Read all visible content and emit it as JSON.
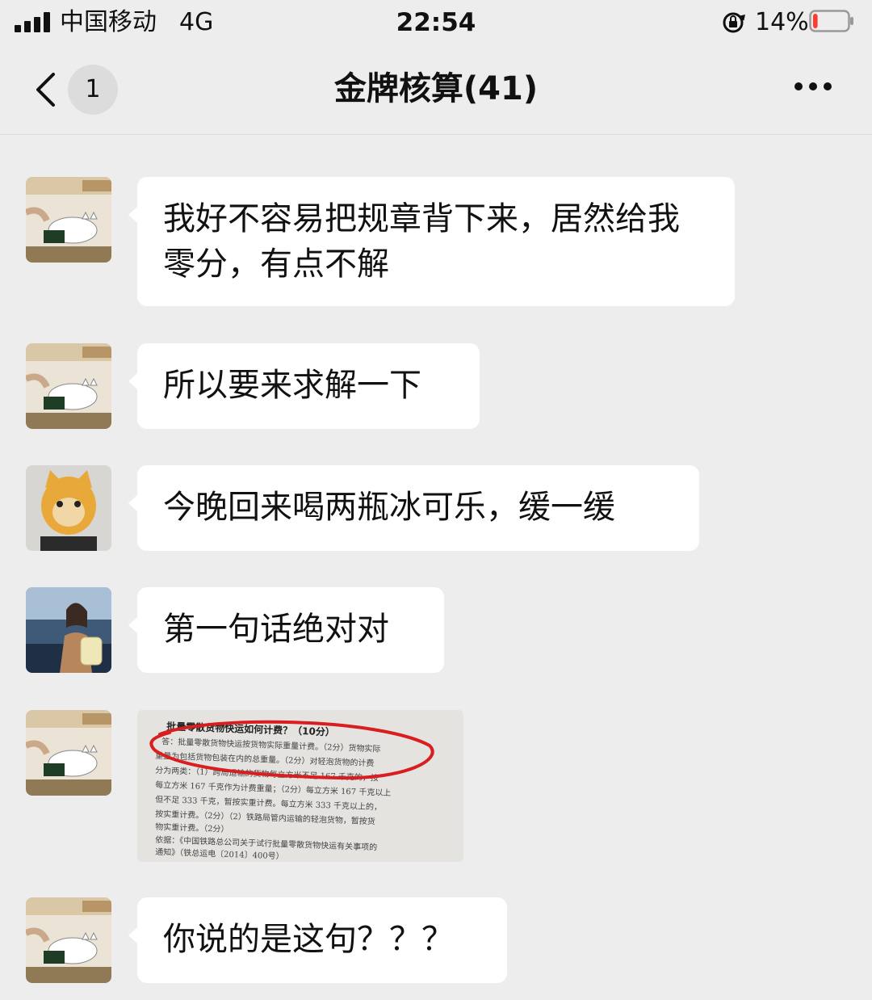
{
  "status_bar": {
    "carrier": "中国移动",
    "network": "4G",
    "time": "22:54",
    "battery_percent": "14%",
    "battery_level": 0.14,
    "battery_color": "#ff3b30"
  },
  "nav": {
    "back_icon": "chevron-left-icon",
    "unread_count": "1",
    "title": "金牌核算(41)",
    "more_icon": "more-dots-icon"
  },
  "messages": [
    {
      "sender_avatar": "cat-cartoon-avatar",
      "text": "我好不容易把规章背下来，居然给我零分，有点不解"
    },
    {
      "sender_avatar": "cat-cartoon-avatar",
      "text": "所以要来求解一下"
    },
    {
      "sender_avatar": "orange-cat-avatar",
      "text": "今晚回来喝两瓶冰可乐，缓一缓"
    },
    {
      "sender_avatar": "person-photo-avatar",
      "text": "第一句话绝对对"
    },
    {
      "sender_avatar": "cat-cartoon-avatar",
      "image": {
        "kind": "exam-photo",
        "highlight_color": "#d81e1e",
        "heading": "批量零散货物快运如何计费？（10分）",
        "lines": [
          "答：批量零散货物快运按货物实际重量计费。（2分）货物实际",
          "重量为包括货物包装在内的总重量。（2分）对轻泡货物的计费",
          "分为两类：（1）跨局运输的货物每立方米不足 167 千克的，按",
          "每立方米 167 千克作为计费重量；（2分）每立方米 167 千克以上",
          "但不足 333 千克，暂按实重计费。每立方米 333 千克以上的，",
          "按实重计费。（2分）（2）铁路局管内运输的轻泡货物，暂按货",
          "物实重计费。（2分）",
          "依据：《中国铁路总公司关于试行批量零散货物快运有关事项的",
          "通知》（铁总运电〔2014〕400号）"
        ]
      }
    },
    {
      "sender_avatar": "cat-cartoon-avatar",
      "text": "你说的是这句？？？"
    }
  ]
}
